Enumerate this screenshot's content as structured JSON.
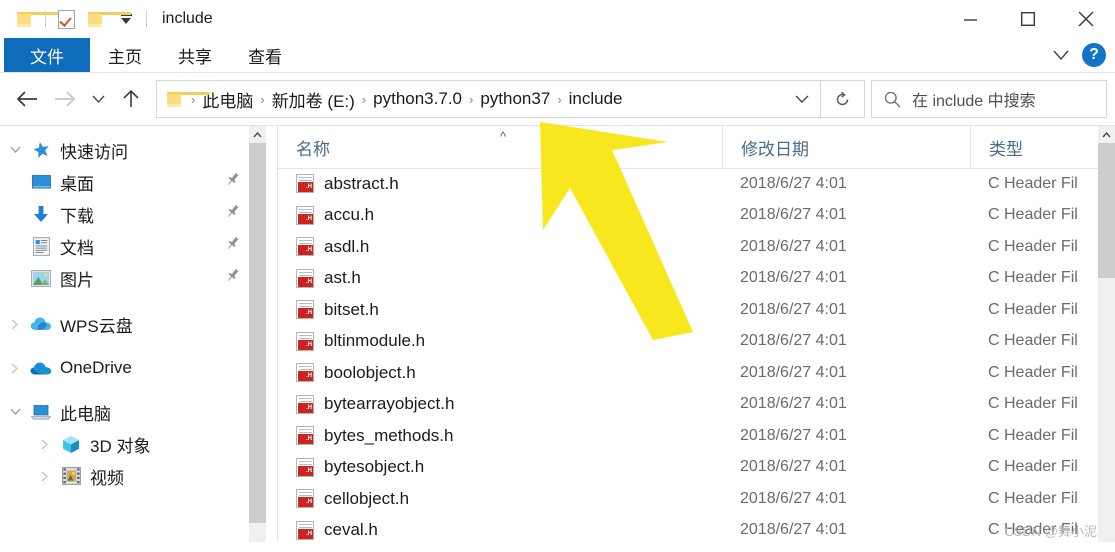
{
  "window": {
    "title": "include",
    "quick_access": [
      {
        "name": "folder-icon",
        "label": "文件资源管理器"
      },
      {
        "name": "properties-icon",
        "label": "属性"
      },
      {
        "name": "new-folder-icon",
        "label": "新建文件夹"
      },
      {
        "name": "customize-caret-icon",
        "label": "自定义快速访问工具栏"
      }
    ],
    "controls": {
      "minimize": "最小化",
      "maximize": "最大化",
      "close": "关闭"
    }
  },
  "ribbon": {
    "tabs": [
      {
        "label": "文件",
        "active": true
      },
      {
        "label": "主页",
        "active": false
      },
      {
        "label": "共享",
        "active": false
      },
      {
        "label": "查看",
        "active": false
      }
    ],
    "expand_label": "展开功能区",
    "help_label": "?"
  },
  "nav": {
    "back": "后退",
    "forward": "前进",
    "recent": "最近浏览的位置",
    "up": "向上",
    "refresh": "刷新",
    "breadcrumb": [
      "此电脑",
      "新加卷 (E:)",
      "python3.7.0",
      "python37",
      "include"
    ],
    "breadcrumb_separator": "›"
  },
  "search": {
    "placeholder": "在 include 中搜索"
  },
  "sidebar": {
    "items": [
      {
        "label": "快速访问",
        "icon": "star-icon",
        "expander": "down",
        "indent": 0,
        "pinned": false
      },
      {
        "label": "桌面",
        "icon": "desktop-icon",
        "expander": "none",
        "indent": 1,
        "pinned": true
      },
      {
        "label": "下载",
        "icon": "downloads-icon",
        "expander": "none",
        "indent": 1,
        "pinned": true
      },
      {
        "label": "文档",
        "icon": "documents-icon",
        "expander": "none",
        "indent": 1,
        "pinned": true
      },
      {
        "label": "图片",
        "icon": "pictures-icon",
        "expander": "none",
        "indent": 1,
        "pinned": true
      },
      {
        "label": "WPS云盘",
        "icon": "wps-cloud-icon",
        "expander": "right",
        "indent": 0,
        "pinned": false
      },
      {
        "label": "OneDrive",
        "icon": "onedrive-cloud-icon",
        "expander": "right",
        "indent": 0,
        "pinned": false
      },
      {
        "label": "此电脑",
        "icon": "this-pc-icon",
        "expander": "down",
        "indent": 0,
        "pinned": false
      },
      {
        "label": "3D 对象",
        "icon": "3d-objects-icon",
        "expander": "right",
        "indent": 1,
        "pinned": false
      },
      {
        "label": "视频",
        "icon": "videos-icon",
        "expander": "right",
        "indent": 1,
        "pinned": false
      }
    ]
  },
  "filelist": {
    "columns": [
      {
        "label": "名称",
        "key": "name"
      },
      {
        "label": "修改日期",
        "key": "date"
      },
      {
        "label": "类型",
        "key": "type"
      }
    ],
    "sort_indicator": "^",
    "rows": [
      {
        "name": "abstract.h",
        "date": "2018/6/27 4:01",
        "type": "C Header Fil",
        "icon": "c-header-file-icon"
      },
      {
        "name": "accu.h",
        "date": "2018/6/27 4:01",
        "type": "C Header Fil",
        "icon": "c-header-file-icon"
      },
      {
        "name": "asdl.h",
        "date": "2018/6/27 4:01",
        "type": "C Header Fil",
        "icon": "c-header-file-icon"
      },
      {
        "name": "ast.h",
        "date": "2018/6/27 4:01",
        "type": "C Header Fil",
        "icon": "c-header-file-icon"
      },
      {
        "name": "bitset.h",
        "date": "2018/6/27 4:01",
        "type": "C Header Fil",
        "icon": "c-header-file-icon"
      },
      {
        "name": "bltinmodule.h",
        "date": "2018/6/27 4:01",
        "type": "C Header Fil",
        "icon": "c-header-file-icon"
      },
      {
        "name": "boolobject.h",
        "date": "2018/6/27 4:01",
        "type": "C Header Fil",
        "icon": "c-header-file-icon"
      },
      {
        "name": "bytearrayobject.h",
        "date": "2018/6/27 4:01",
        "type": "C Header Fil",
        "icon": "c-header-file-icon"
      },
      {
        "name": "bytes_methods.h",
        "date": "2018/6/27 4:01",
        "type": "C Header Fil",
        "icon": "c-header-file-icon"
      },
      {
        "name": "bytesobject.h",
        "date": "2018/6/27 4:01",
        "type": "C Header Fil",
        "icon": "c-header-file-icon"
      },
      {
        "name": "cellobject.h",
        "date": "2018/6/27 4:01",
        "type": "C Header Fil",
        "icon": "c-header-file-icon"
      },
      {
        "name": "ceval.h",
        "date": "2018/6/27 4:01",
        "type": "C Header Fil",
        "icon": "c-header-file-icon"
      }
    ]
  },
  "annotation": {
    "shape": "arrow",
    "color": "#F8E71C",
    "points_at": "python37"
  },
  "watermark": {
    "text": "CSDN @舞小泥"
  },
  "colors": {
    "accent": "#0f6cbd",
    "column_header_text": "#4b6b8a",
    "secondary_text": "#6b6b6b",
    "annotation": "#F8E71C",
    "scrollbar_thumb": "#cdcdcd",
    "scrollbar_track": "#f0f0f0"
  }
}
